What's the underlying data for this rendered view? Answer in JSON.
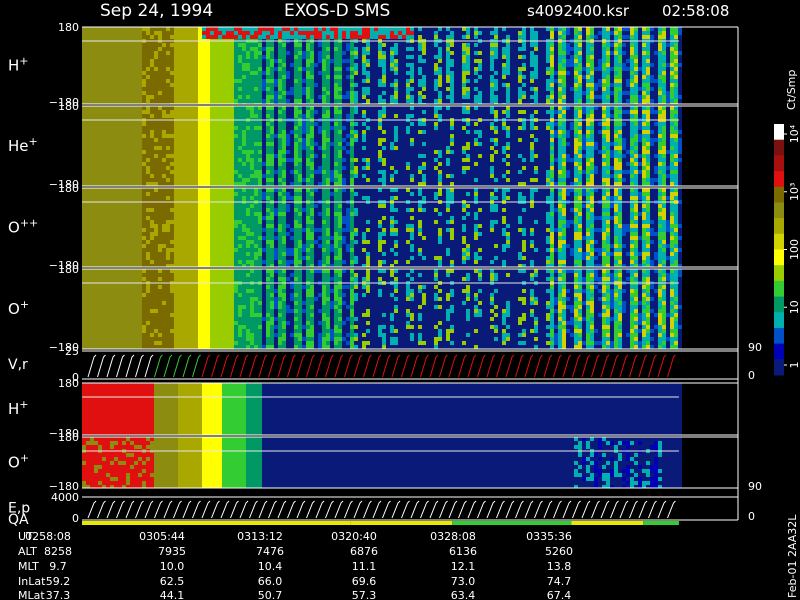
{
  "header": {
    "date": "Sep 24, 1994",
    "instrument": "EXOS-D SMS",
    "file": "s4092400.ksr",
    "time": "02:58:08"
  },
  "chart_data": {
    "type": "heatmap",
    "panels": [
      {
        "kind": "spectrogram",
        "ion": "H",
        "charge": "+",
        "y_top": "180",
        "y_bottom": "−180"
      },
      {
        "kind": "spectrogram",
        "ion": "He",
        "charge": "+",
        "y_top": "180",
        "y_bottom": "−180"
      },
      {
        "kind": "spectrogram",
        "ion": "O",
        "charge": "++",
        "y_top": "180",
        "y_bottom": "−180"
      },
      {
        "kind": "spectrogram",
        "ion": "O",
        "charge": "+",
        "y_top": "180",
        "y_bottom": "−180",
        "right_label": "90"
      },
      {
        "kind": "line",
        "label": "V,r",
        "y_top": "25",
        "y_bottom": "0",
        "right_label": "0"
      },
      {
        "kind": "spectrogram",
        "ion": "H",
        "charge": "+",
        "y_top": "180",
        "y_bottom": "−180"
      },
      {
        "kind": "spectrogram",
        "ion": "O",
        "charge": "+",
        "y_top": "180",
        "y_bottom": "−180",
        "right_label": "90"
      },
      {
        "kind": "line",
        "label": "E,p",
        "label2": "QA",
        "y_top": "4000",
        "y_bottom": "0",
        "right_label": "0"
      }
    ],
    "colorbar": {
      "unit": "Ct/Smp",
      "scale": "log",
      "tick_labels": [
        "10⁴",
        "10³",
        "100",
        "10",
        "1"
      ],
      "tick_values": [
        10000,
        1000,
        100,
        10,
        1
      ],
      "colors": [
        "#ffffff",
        "#7a1010",
        "#a81010",
        "#e01010",
        "#7a6a00",
        "#8c8c10",
        "#a8a800",
        "#d2d200",
        "#ffff00",
        "#9acd00",
        "#33cc33",
        "#009966",
        "#00b0b0",
        "#0050c8",
        "#0000b4",
        "#0a1a78"
      ]
    },
    "time_axis": {
      "rows": [
        {
          "label": "UT",
          "values": [
            "0258:08",
            "0305:44",
            "0313:12",
            "0320:40",
            "0328:08",
            "0335:36"
          ]
        },
        {
          "label": "ALT",
          "values": [
            "8258",
            "7935",
            "7476",
            "6876",
            "6136",
            "5260"
          ]
        },
        {
          "label": "MLT",
          "values": [
            "9.7",
            "10.0",
            "10.4",
            "11.1",
            "12.1",
            "13.8"
          ]
        },
        {
          "label": "InLat",
          "values": [
            "59.2",
            "62.5",
            "66.0",
            "69.6",
            "73.0",
            "74.7"
          ]
        },
        {
          "label": "MLat",
          "values": [
            "37.3",
            "44.1",
            "50.7",
            "57.3",
            "63.4",
            "67.4"
          ]
        }
      ]
    },
    "data_end_fraction": 0.91
  },
  "footer": {
    "stamp": "Feb-01 2AA32L"
  }
}
